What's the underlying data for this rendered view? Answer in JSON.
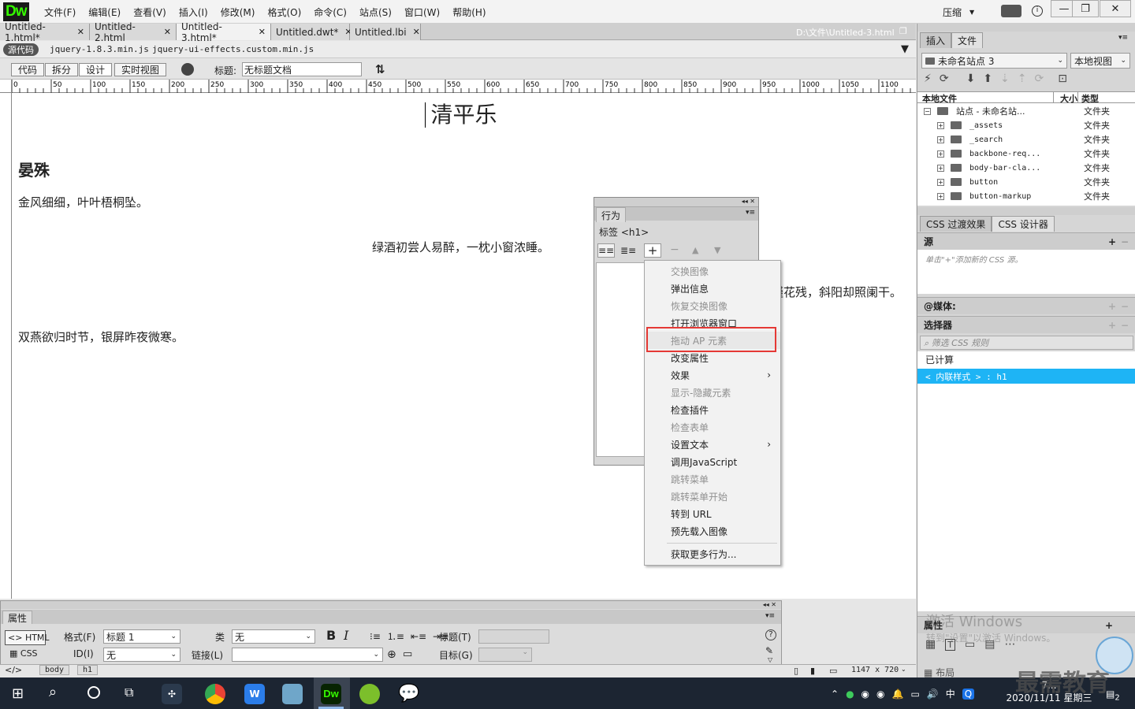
{
  "app": {
    "logo": "Dw"
  },
  "menubar": {
    "items": [
      "文件(F)",
      "编辑(E)",
      "查看(V)",
      "插入(I)",
      "修改(M)",
      "格式(O)",
      "命令(C)",
      "站点(S)",
      "窗口(W)",
      "帮助(H)"
    ],
    "compress_label": "压缩"
  },
  "doc_tabs": [
    {
      "label": "Untitled-1.html*",
      "active": false
    },
    {
      "label": "Untitled-2.html",
      "active": false
    },
    {
      "label": "Untitled-3.html*",
      "active": true
    },
    {
      "label": "Untitled.dwt*",
      "active": false
    },
    {
      "label": "Untitled.lbi",
      "active": false
    }
  ],
  "doc_path": "D:\\文件\\Untitled-3.html",
  "related_files": {
    "source_label": "源代码",
    "files": [
      "jquery-1.8.3.min.js",
      "jquery-ui-effects.custom.min.js"
    ]
  },
  "doc_toolbar": {
    "views": [
      "代码",
      "拆分",
      "设计",
      "实时视图"
    ],
    "active_view": "设计",
    "title_label": "标题:",
    "title_value": "无标题文档"
  },
  "ruler": {
    "ticks": [
      "0",
      "50",
      "100",
      "150",
      "200",
      "250",
      "300",
      "350",
      "400",
      "450",
      "500",
      "550",
      "600",
      "650",
      "700",
      "750",
      "800",
      "850",
      "900",
      "950",
      "1000",
      "1050",
      "1100"
    ]
  },
  "document": {
    "h1": "清平乐",
    "h2": "晏殊",
    "lines": [
      "金风细细，叶叶梧桐坠。",
      "绿酒初尝人易醉，一枕小窗浓睡。",
      "槿花残，斜阳却照阑干。",
      "双燕欲归时节，银屏昨夜微寒。"
    ]
  },
  "behaviors_panel": {
    "tab": "行为",
    "tag_label": "标签 <h1>"
  },
  "context_menu": {
    "items": [
      {
        "label": "交换图像",
        "enabled": false,
        "submenu": false
      },
      {
        "label": "弹出信息",
        "enabled": true,
        "submenu": false
      },
      {
        "label": "恢复交换图像",
        "enabled": false,
        "submenu": false
      },
      {
        "label": "打开浏览器窗口",
        "enabled": true,
        "submenu": false
      },
      {
        "label": "拖动 AP 元素",
        "enabled": false,
        "submenu": false,
        "highlighted": true
      },
      {
        "label": "改变属性",
        "enabled": true,
        "submenu": false
      },
      {
        "label": "效果",
        "enabled": true,
        "submenu": true
      },
      {
        "label": "显示-隐藏元素",
        "enabled": false,
        "submenu": false
      },
      {
        "label": "检查插件",
        "enabled": true,
        "submenu": false
      },
      {
        "label": "检查表单",
        "enabled": false,
        "submenu": false
      },
      {
        "label": "设置文本",
        "enabled": true,
        "submenu": true
      },
      {
        "label": "调用JavaScript",
        "enabled": true,
        "submenu": false
      },
      {
        "label": "跳转菜单",
        "enabled": false,
        "submenu": false
      },
      {
        "label": "跳转菜单开始",
        "enabled": false,
        "submenu": false
      },
      {
        "label": "转到 URL",
        "enabled": true,
        "submenu": false
      },
      {
        "label": "预先载入图像",
        "enabled": true,
        "submenu": false
      }
    ],
    "more_label": "获取更多行为...",
    "highlight_color": "#e53935"
  },
  "files_panel": {
    "tabs": [
      "插入",
      "文件"
    ],
    "active_tab": "文件",
    "site_select": "未命名站点 3",
    "view_select": "本地视图",
    "columns": [
      "本地文件",
      "大小",
      "类型"
    ],
    "root": {
      "name": "站点 - 未命名站...",
      "type": "文件夹"
    },
    "entries": [
      {
        "name": "_assets",
        "type": "文件夹"
      },
      {
        "name": "_search",
        "type": "文件夹"
      },
      {
        "name": "backbone-req...",
        "type": "文件夹"
      },
      {
        "name": "body-bar-cla...",
        "type": "文件夹"
      },
      {
        "name": "button",
        "type": "文件夹"
      },
      {
        "name": "button-markup",
        "type": "文件夹"
      }
    ]
  },
  "css_panel": {
    "tabs": [
      "CSS 过渡效果",
      "CSS 设计器"
    ],
    "active_tab": "CSS 设计器",
    "source_label": "源",
    "source_hint": "单击\"+\"添加新的 CSS 源。",
    "media_label": "@媒体:",
    "selector_label": "选择器",
    "filter_placeholder": "筛选 CSS 规则",
    "computed_label": "已计算",
    "selected_rule": "< 内联样式 > : h1",
    "selected_color": "#1eb4f5",
    "props_label": "属性",
    "layout_label": "布局"
  },
  "property_inspector": {
    "tab": "属性",
    "html_btn": "HTML",
    "css_btn": "CSS",
    "format_label": "格式(F)",
    "format_value": "标题 1",
    "class_label": "类",
    "class_value": "无",
    "id_label": "ID(I)",
    "id_value": "无",
    "link_label": "链接(L)",
    "title_label": "标题(T)",
    "target_label": "目标(G)",
    "bold": "B",
    "italic": "I"
  },
  "status_bar": {
    "tags": [
      "body",
      "h1"
    ],
    "size": "1147 x 720"
  },
  "watermark": {
    "line1": "激活 Windows",
    "line2": "转到\"设置\"以激活 Windows。"
  },
  "brand_overlay": "最需教育",
  "taskbar": {
    "ime": "中",
    "time": "7...",
    "date": "2020/11/11 星期三",
    "badge": "2"
  }
}
